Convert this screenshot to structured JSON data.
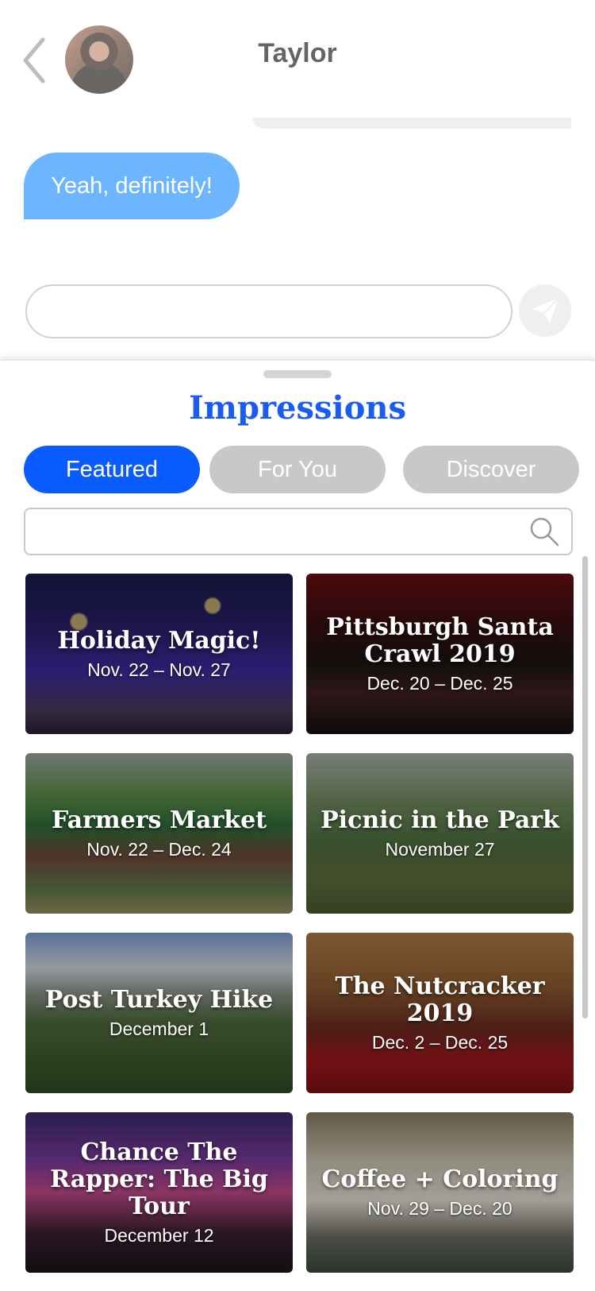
{
  "chat": {
    "title": "Taylor",
    "back_icon": "chevron-left-icon",
    "outgoing_message": "Yeah, definitely!",
    "message_input_placeholder": "",
    "send_icon": "paper-plane-icon",
    "accent_color": "#1f8fff"
  },
  "sheet": {
    "title": "Impressions",
    "tabs": [
      {
        "label": "Featured",
        "active": true
      },
      {
        "label": "For You",
        "active": false
      },
      {
        "label": "Discover",
        "active": false
      }
    ],
    "search_placeholder": "",
    "search_icon": "search-icon",
    "accent_color": "#0a5cff",
    "events": [
      {
        "title": "Holiday Magic!",
        "date": "Nov. 22 – Nov. 27"
      },
      {
        "title": "Pittsburgh Santa Crawl 2019",
        "date": "Dec. 20 – Dec. 25"
      },
      {
        "title": "Farmers Market",
        "date": "Nov. 22 – Dec. 24"
      },
      {
        "title": "Picnic in the Park",
        "date": "November 27"
      },
      {
        "title": "Post Turkey Hike",
        "date": "December 1"
      },
      {
        "title": "The Nutcracker 2019",
        "date": "Dec. 2 – Dec. 25"
      },
      {
        "title": "Chance The Rapper: The Big Tour",
        "date": "December 12"
      },
      {
        "title": "Coffee + Coloring",
        "date": "Nov. 29 – Dec. 20"
      }
    ]
  }
}
